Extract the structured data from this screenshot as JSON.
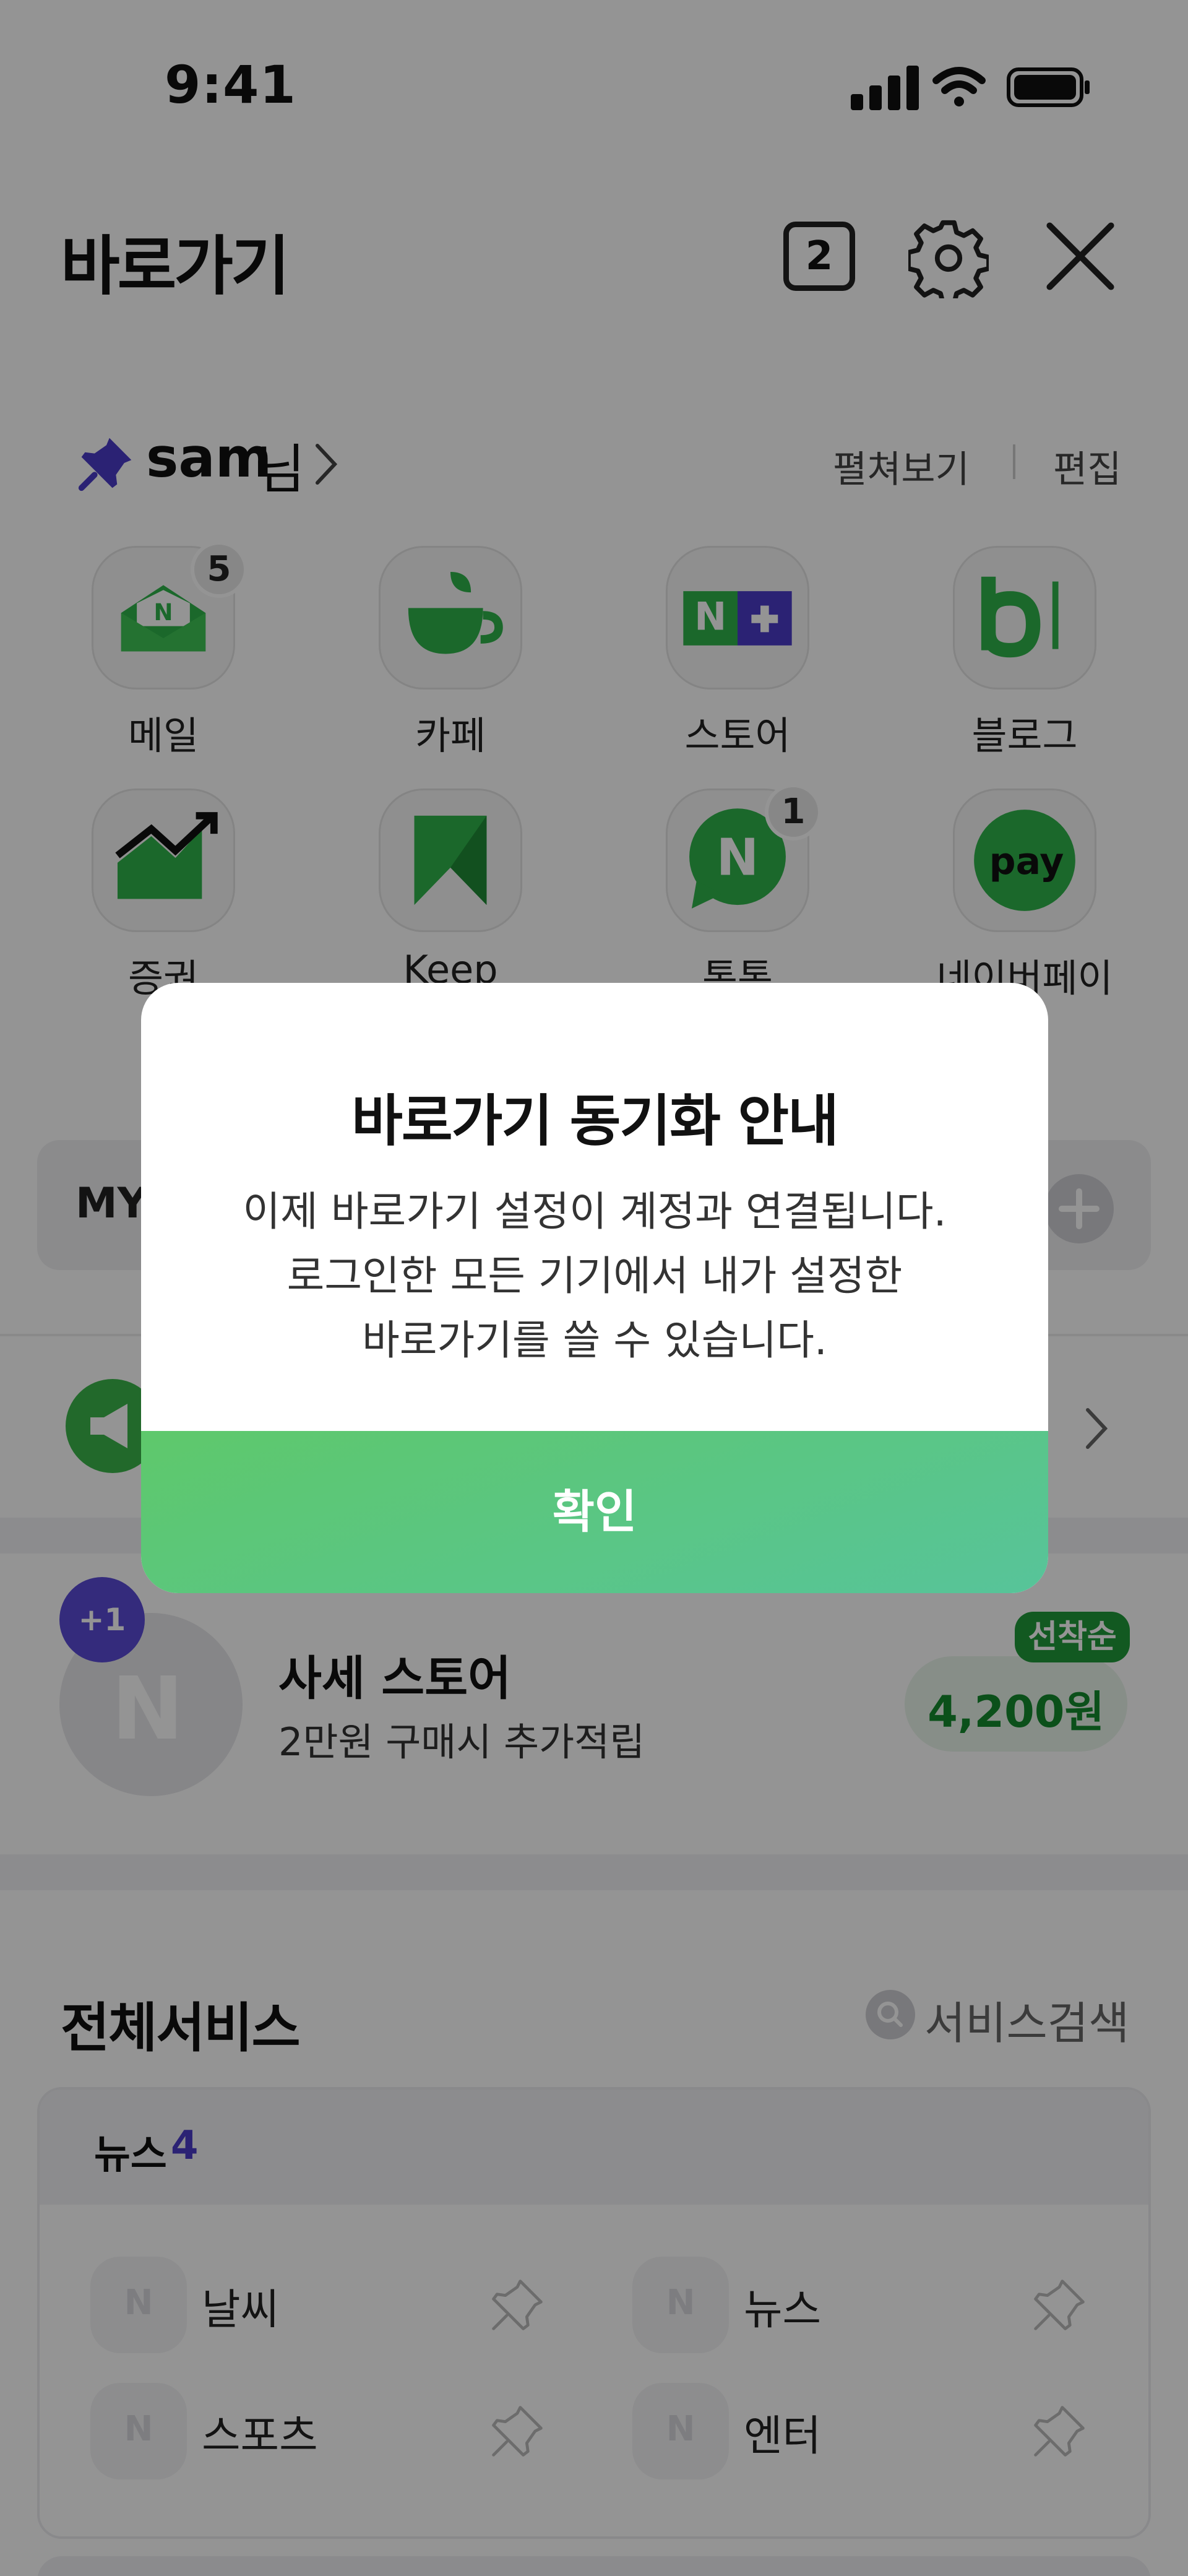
{
  "status_bar": {
    "time": "9:41"
  },
  "header": {
    "title": "바로가기",
    "tab_count": "2"
  },
  "pinned": {
    "user_name": "sam",
    "user_suffix": "님",
    "unfold_label": "펼쳐보기",
    "edit_label": "편집",
    "apps": [
      {
        "label": "메일",
        "badge": "5",
        "icon": "mail-icon"
      },
      {
        "label": "카페",
        "badge": "",
        "icon": "cafe-icon"
      },
      {
        "label": "스토어",
        "badge": "",
        "icon": "store-icon"
      },
      {
        "label": "블로그",
        "badge": "",
        "icon": "blog-icon"
      },
      {
        "label": "증권",
        "badge": "",
        "icon": "stock-icon"
      },
      {
        "label": "Keep",
        "badge": "",
        "icon": "keep-icon"
      },
      {
        "label": "톡톡",
        "badge": "1",
        "icon": "talktalk-icon"
      },
      {
        "label": "네이버페이",
        "badge": "",
        "icon": "pay-icon",
        "icon_text": "pay"
      }
    ]
  },
  "my_section": {
    "label": "MY"
  },
  "promo": {
    "plus_badge": "+1",
    "avatar_letter": "N",
    "title": "사세 스토어",
    "subtitle": "2만원 구매시 추가적립",
    "tag": "선착순",
    "amount": "4,200원"
  },
  "all_services": {
    "title": "전체서비스",
    "search_label": "서비스검색",
    "category": {
      "label": "뉴스",
      "count": "4"
    },
    "items": [
      {
        "label": "날씨"
      },
      {
        "label": "뉴스"
      },
      {
        "label": "스포츠"
      },
      {
        "label": "엔터"
      }
    ],
    "tile_letter": "N"
  },
  "dialog": {
    "title": "바로가기 동기화 안내",
    "body_lines": [
      "이제 바로가기 설정이 계정과 연결됩니다.",
      "로그인한 모든 기기에서 내가 설정한",
      "바로가기를 쓸 수 있습니다."
    ],
    "confirm_label": "확인"
  },
  "colors": {
    "brand_green": "#03c75a",
    "accent_purple": "#5b4ad6",
    "dialog_button": "#5ec86b"
  }
}
